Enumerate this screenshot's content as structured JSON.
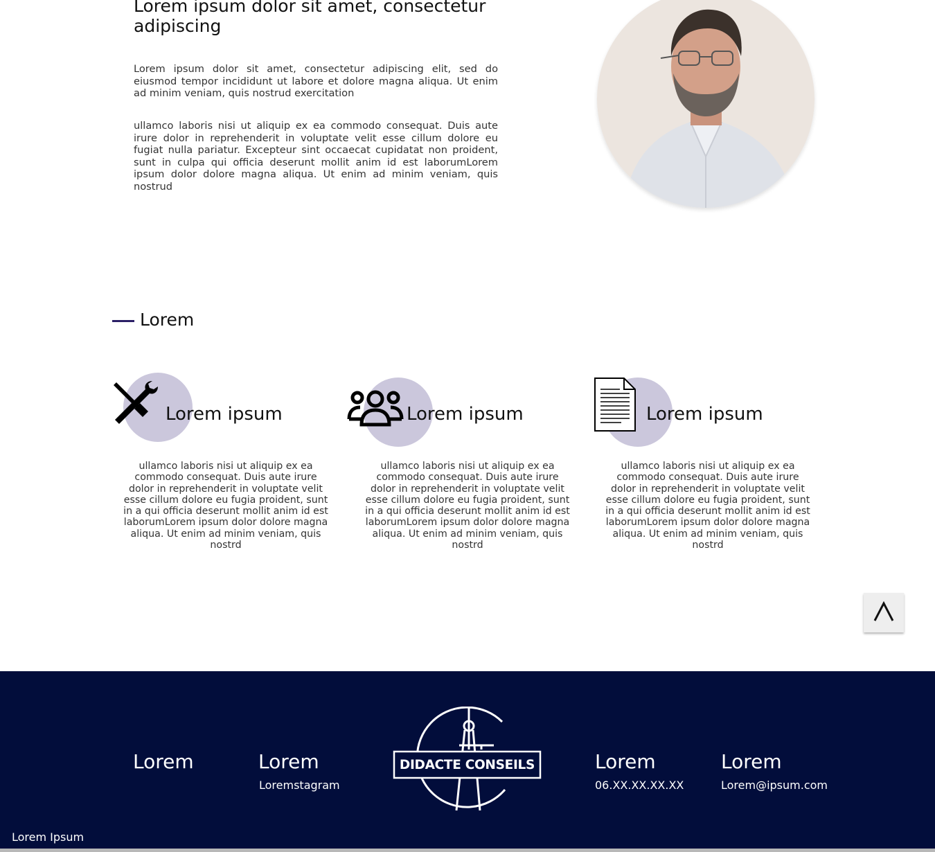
{
  "intro": {
    "title": "Lorem ipsum dolor sit amet, consectetur adipiscing",
    "paragraph1": "Lorem ipsum dolor sit amet, consectetur adipiscing elit, sed do eiusmod tempor incididunt ut labore et dolore magna aliqua. Ut enim ad minim veniam, quis nostrud exercitation",
    "paragraph2": "ullamco laboris nisi ut aliquip ex ea commodo consequat. Duis aute irure dolor in reprehenderit in voluptate velit esse cillum dolore eu fugiat nulla pariatur. Excepteur sint occaecat cupidatat non proident, sunt in culpa qui officia deserunt mollit anim id est laborumLorem ipsum dolor  dolore magna aliqua. Ut enim ad minim veniam, quis nostrud"
  },
  "section": {
    "title": "Lorem"
  },
  "features": [
    {
      "icon": "tools-icon",
      "title": "Lorem ipsum",
      "text": "ullamco laboris nisi ut aliquip ex ea commodo consequat. Duis aute irure dolor in reprehenderit in voluptate velit esse cillum dolore eu fugia proident, sunt in a qui officia deserunt mollit anim id est laborumLorem ipsum dolor dolore magna aliqua. Ut enim ad minim veniam, quis nostrd"
    },
    {
      "icon": "users-icon",
      "title": "Lorem ipsum",
      "text": "ullamco laboris nisi ut aliquip ex ea commodo consequat. Duis aute irure dolor in reprehenderit in voluptate velit esse cillum dolore eu fugia proident, sunt in a qui officia deserunt mollit anim id est laborumLorem ipsum dolor dolore magna aliqua. Ut enim ad minim veniam, quis nostrd"
    },
    {
      "icon": "document-icon",
      "title": "Lorem ipsum",
      "text": "ullamco laboris nisi ut aliquip ex ea commodo consequat. Duis aute irure dolor in reprehenderit in voluptate velit esse cillum dolore eu fugia proident, sunt in a qui officia deserunt mollit anim id est laborumLorem ipsum dolor dolore magna aliqua. Ut enim ad minim veniam, quis nostrd"
    }
  ],
  "scroll_top": {
    "label": "^"
  },
  "footer": {
    "col1": {
      "title": "Lorem"
    },
    "col2": {
      "title": "Lorem",
      "link": "Loremstagram"
    },
    "logo_text": "DIDACTE CONSEILS",
    "col3": {
      "title": "Lorem",
      "phone": "06.XX.XX.XX.XX"
    },
    "col4": {
      "title": "Lorem",
      "email": "Lorem@ipsum.com"
    },
    "bottom_text": "Lorem Ipsum"
  },
  "colors": {
    "accent": "#2b1f66",
    "footer_bg": "#020d3b",
    "circle": "#cbc7dc"
  }
}
